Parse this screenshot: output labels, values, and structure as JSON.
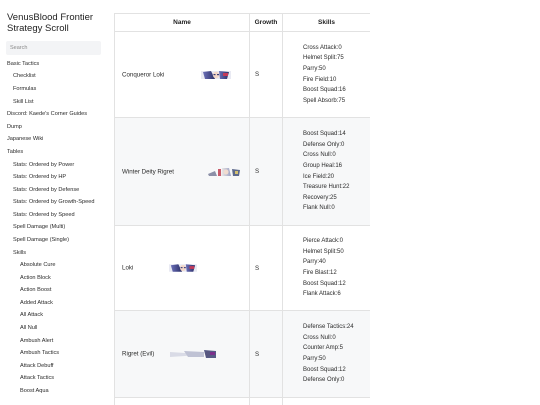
{
  "site": {
    "title": "VenusBlood Frontier Strategy Scroll"
  },
  "search": {
    "placeholder": "Search"
  },
  "nav": [
    {
      "label": "Basic Tactics",
      "level": 0
    },
    {
      "label": "Checklist",
      "level": 1
    },
    {
      "label": "Formulas",
      "level": 1
    },
    {
      "label": "Skill List",
      "level": 1
    },
    {
      "label": "Discord: Kaede's Corner Guides",
      "level": 0
    },
    {
      "label": "Dump",
      "level": 0
    },
    {
      "label": "Japanese Wiki",
      "level": 0
    },
    {
      "label": "Tables",
      "level": 0
    },
    {
      "label": "Stats: Ordered by Power",
      "level": 1
    },
    {
      "label": "Stats: Ordered by HP",
      "level": 1
    },
    {
      "label": "Stats: Ordered by Defense",
      "level": 1
    },
    {
      "label": "Stats: Ordered by Growth-Speed",
      "level": 1
    },
    {
      "label": "Stats: Ordered by Speed",
      "level": 1
    },
    {
      "label": "Spell Damage (Multi)",
      "level": 1
    },
    {
      "label": "Spell Damage (Single)",
      "level": 1
    },
    {
      "label": "Skills",
      "level": 1
    },
    {
      "label": "Absolute Cure",
      "level": 2
    },
    {
      "label": "Action Block",
      "level": 2
    },
    {
      "label": "Action Boost",
      "level": 2
    },
    {
      "label": "Added Attack",
      "level": 2
    },
    {
      "label": "All Attack",
      "level": 2
    },
    {
      "label": "All Null",
      "level": 2
    },
    {
      "label": "Ambush Alert",
      "level": 2
    },
    {
      "label": "Ambush Tactics",
      "level": 2
    },
    {
      "label": "Attack Debuff",
      "level": 2
    },
    {
      "label": "Attack Tactics",
      "level": 2
    },
    {
      "label": "Boost Aqua",
      "level": 2
    }
  ],
  "table": {
    "headers": {
      "name": "Name",
      "growth": "Growth",
      "skills": "Skills"
    },
    "rows": [
      {
        "name": "Conqueror Loki",
        "growth": "S",
        "sprite": "conqueror-loki-sprite",
        "skills": [
          "Cross Attack:0",
          "Helmet Split:75",
          "Parry:50",
          "Fire Field:10",
          "Boost Squad:16",
          "Spell Absorb:75"
        ]
      },
      {
        "name": "Winter Deity Rigret",
        "growth": "S",
        "sprite": "winter-deity-rigret-sprite",
        "skills": [
          "Boost Squad:14",
          "Defense Only:0",
          "Cross Null:0",
          "Group Heal:16",
          "Ice Field:20",
          "Treasure Hunt:22",
          "Recovery:25",
          "Flank Null:0"
        ]
      },
      {
        "name": "Loki",
        "growth": "S",
        "sprite": "loki-sprite",
        "skills": [
          "Pierce Attack:0",
          "Helmet Split:50",
          "Parry:40",
          "Fire Blast:12",
          "Boost Squad:12",
          "Flank Attack:6"
        ]
      },
      {
        "name": "Rigret (Evil)",
        "growth": "S",
        "sprite": "rigret-evil-sprite",
        "skills": [
          "Defense Tactics:24",
          "Cross Null:0",
          "Counter Amp:5",
          "Parry:50",
          "Boost Squad:12",
          "Defense Only:0"
        ]
      }
    ]
  },
  "colors": {
    "border": "#e2e2e2",
    "stripe": "#f7f8f9",
    "text": "#2a2a2a",
    "search_bg": "#f3f4f6"
  }
}
